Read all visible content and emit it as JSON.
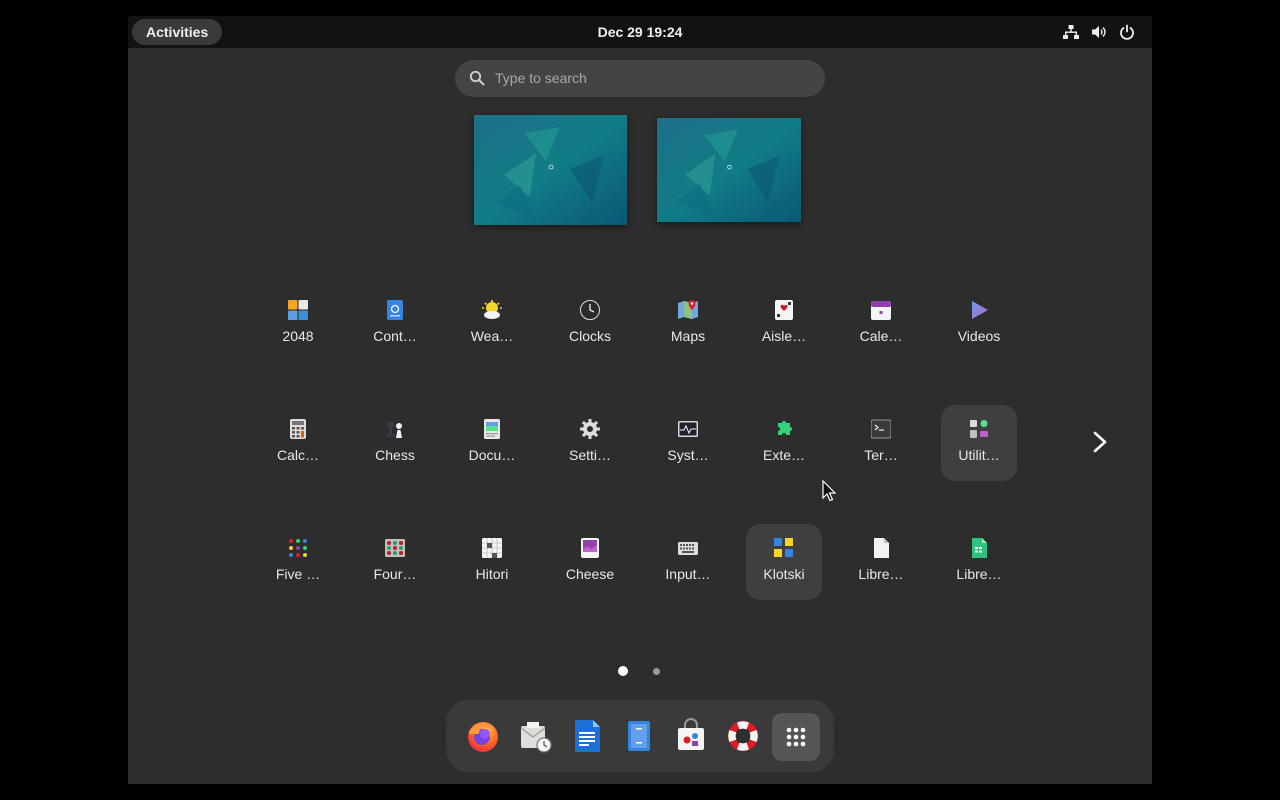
{
  "topbar": {
    "activities_label": "Activities",
    "datetime": "Dec 29  19:24",
    "tray_icons": [
      "network-icon",
      "volume-icon",
      "power-icon"
    ]
  },
  "search": {
    "placeholder": "Type to search"
  },
  "workspaces": [
    "workspace-1",
    "workspace-2"
  ],
  "apps": [
    {
      "label": "2048",
      "icon": "2048-icon"
    },
    {
      "label": "Cont…",
      "icon": "contacts-icon"
    },
    {
      "label": "Wea…",
      "icon": "weather-icon"
    },
    {
      "label": "Clocks",
      "icon": "clocks-icon"
    },
    {
      "label": "Maps",
      "icon": "maps-icon"
    },
    {
      "label": "Aisle…",
      "icon": "aisleriot-icon"
    },
    {
      "label": "Cale…",
      "icon": "calendar-icon"
    },
    {
      "label": "Videos",
      "icon": "videos-icon"
    },
    {
      "label": "Calc…",
      "icon": "calculator-icon"
    },
    {
      "label": "Chess",
      "icon": "chess-icon"
    },
    {
      "label": "Docu…",
      "icon": "document-viewer-icon"
    },
    {
      "label": "Setti…",
      "icon": "settings-icon"
    },
    {
      "label": "Syst…",
      "icon": "system-monitor-icon"
    },
    {
      "label": "Exte…",
      "icon": "extensions-icon"
    },
    {
      "label": "Ter…",
      "icon": "terminal-icon"
    },
    {
      "label": "Utilit…",
      "icon": "utilities-folder-icon"
    },
    {
      "label": "Five …",
      "icon": "five-or-more-icon"
    },
    {
      "label": "Four…",
      "icon": "four-in-a-row-icon"
    },
    {
      "label": "Hitori",
      "icon": "hitori-icon"
    },
    {
      "label": "Cheese",
      "icon": "cheese-icon"
    },
    {
      "label": "Input…",
      "icon": "input-method-icon"
    },
    {
      "label": "Klotski",
      "icon": "klotski-icon"
    },
    {
      "label": "Libre…",
      "icon": "libreoffice-icon"
    },
    {
      "label": "Libre…",
      "icon": "libreoffice-calc-icon"
    }
  ],
  "pagination": {
    "pages": 2,
    "current": 1
  },
  "dash": [
    "firefox-icon",
    "evolution-icon",
    "libreoffice-writer-icon",
    "files-icon",
    "software-icon",
    "help-icon",
    "show-apps-icon"
  ],
  "colors": {
    "background": "#2d2d2d",
    "topbar": "#121212",
    "accent": "#3584e4"
  }
}
